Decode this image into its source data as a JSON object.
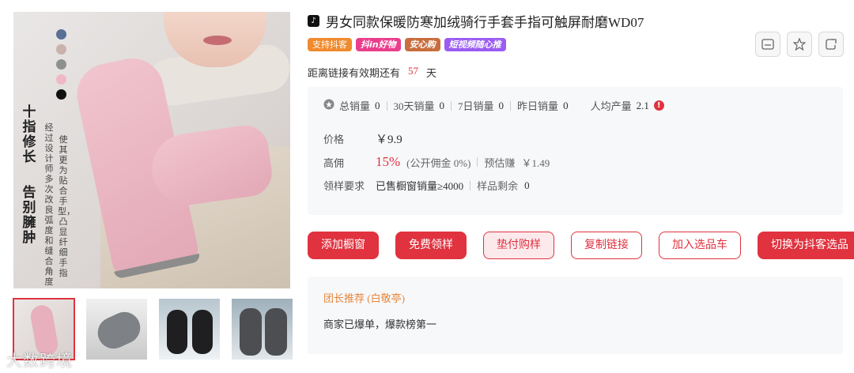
{
  "gallery": {
    "swatch_colors": [
      "#5a6f96",
      "#c9b2a9",
      "#8e9090",
      "#f0b8c6",
      "#111111"
    ],
    "vertical_text_big": [
      "十指修长",
      "告别臃肿"
    ],
    "vertical_text_small": [
      "使其更为贴合手型，凸显纤细手指",
      "经过设计师多次改良弧度和缝合角度"
    ],
    "thumbnails": [
      "pink-glove",
      "gray-glove",
      "black-glove",
      "dark-gray-glove"
    ],
    "watermark": "大数跨境"
  },
  "product": {
    "title": "男女同款保暖防寒加绒骑行手套手指可触屏耐磨WD07",
    "tags": [
      "支持抖客",
      "抖in好物",
      "安心购",
      "短视频随心推"
    ],
    "validity_label": "距离链接有效期还有",
    "validity_days": "57",
    "validity_unit": "天"
  },
  "stats": {
    "total_sales_label": "总销量",
    "total_sales": "0",
    "sales_30_label": "30天销量",
    "sales_30": "0",
    "sales_7_label": "7日销量",
    "sales_7": "0",
    "sales_yesterday_label": "昨日销量",
    "sales_yesterday": "0",
    "per_capita_label": "人均产量",
    "per_capita": "2.1"
  },
  "details": {
    "price_label": "价格",
    "price": "￥9.9",
    "commission_label": "高佣",
    "commission_rate": "15%",
    "public_commission": "(公开佣金 0%)",
    "estimate_label": "预估赚",
    "estimate": "￥1.49",
    "sample_req_label": "领样要求",
    "sample_req": "已售橱窗销量≥4000",
    "sample_left_label": "样品剩余",
    "sample_left": "0"
  },
  "buttons": {
    "add_window": "添加橱窗",
    "free_sample": "免费领样",
    "paid_sample": "垫付购样",
    "copy_link": "复制链接",
    "add_cart": "加入选品车",
    "switch": "切换为抖客选品"
  },
  "recommend": {
    "title": "团长推荐 (白敬亭)",
    "text": "商家已爆单，爆款榜第一"
  },
  "colors": {
    "accent": "#e0323f",
    "orange": "#e8863a"
  }
}
